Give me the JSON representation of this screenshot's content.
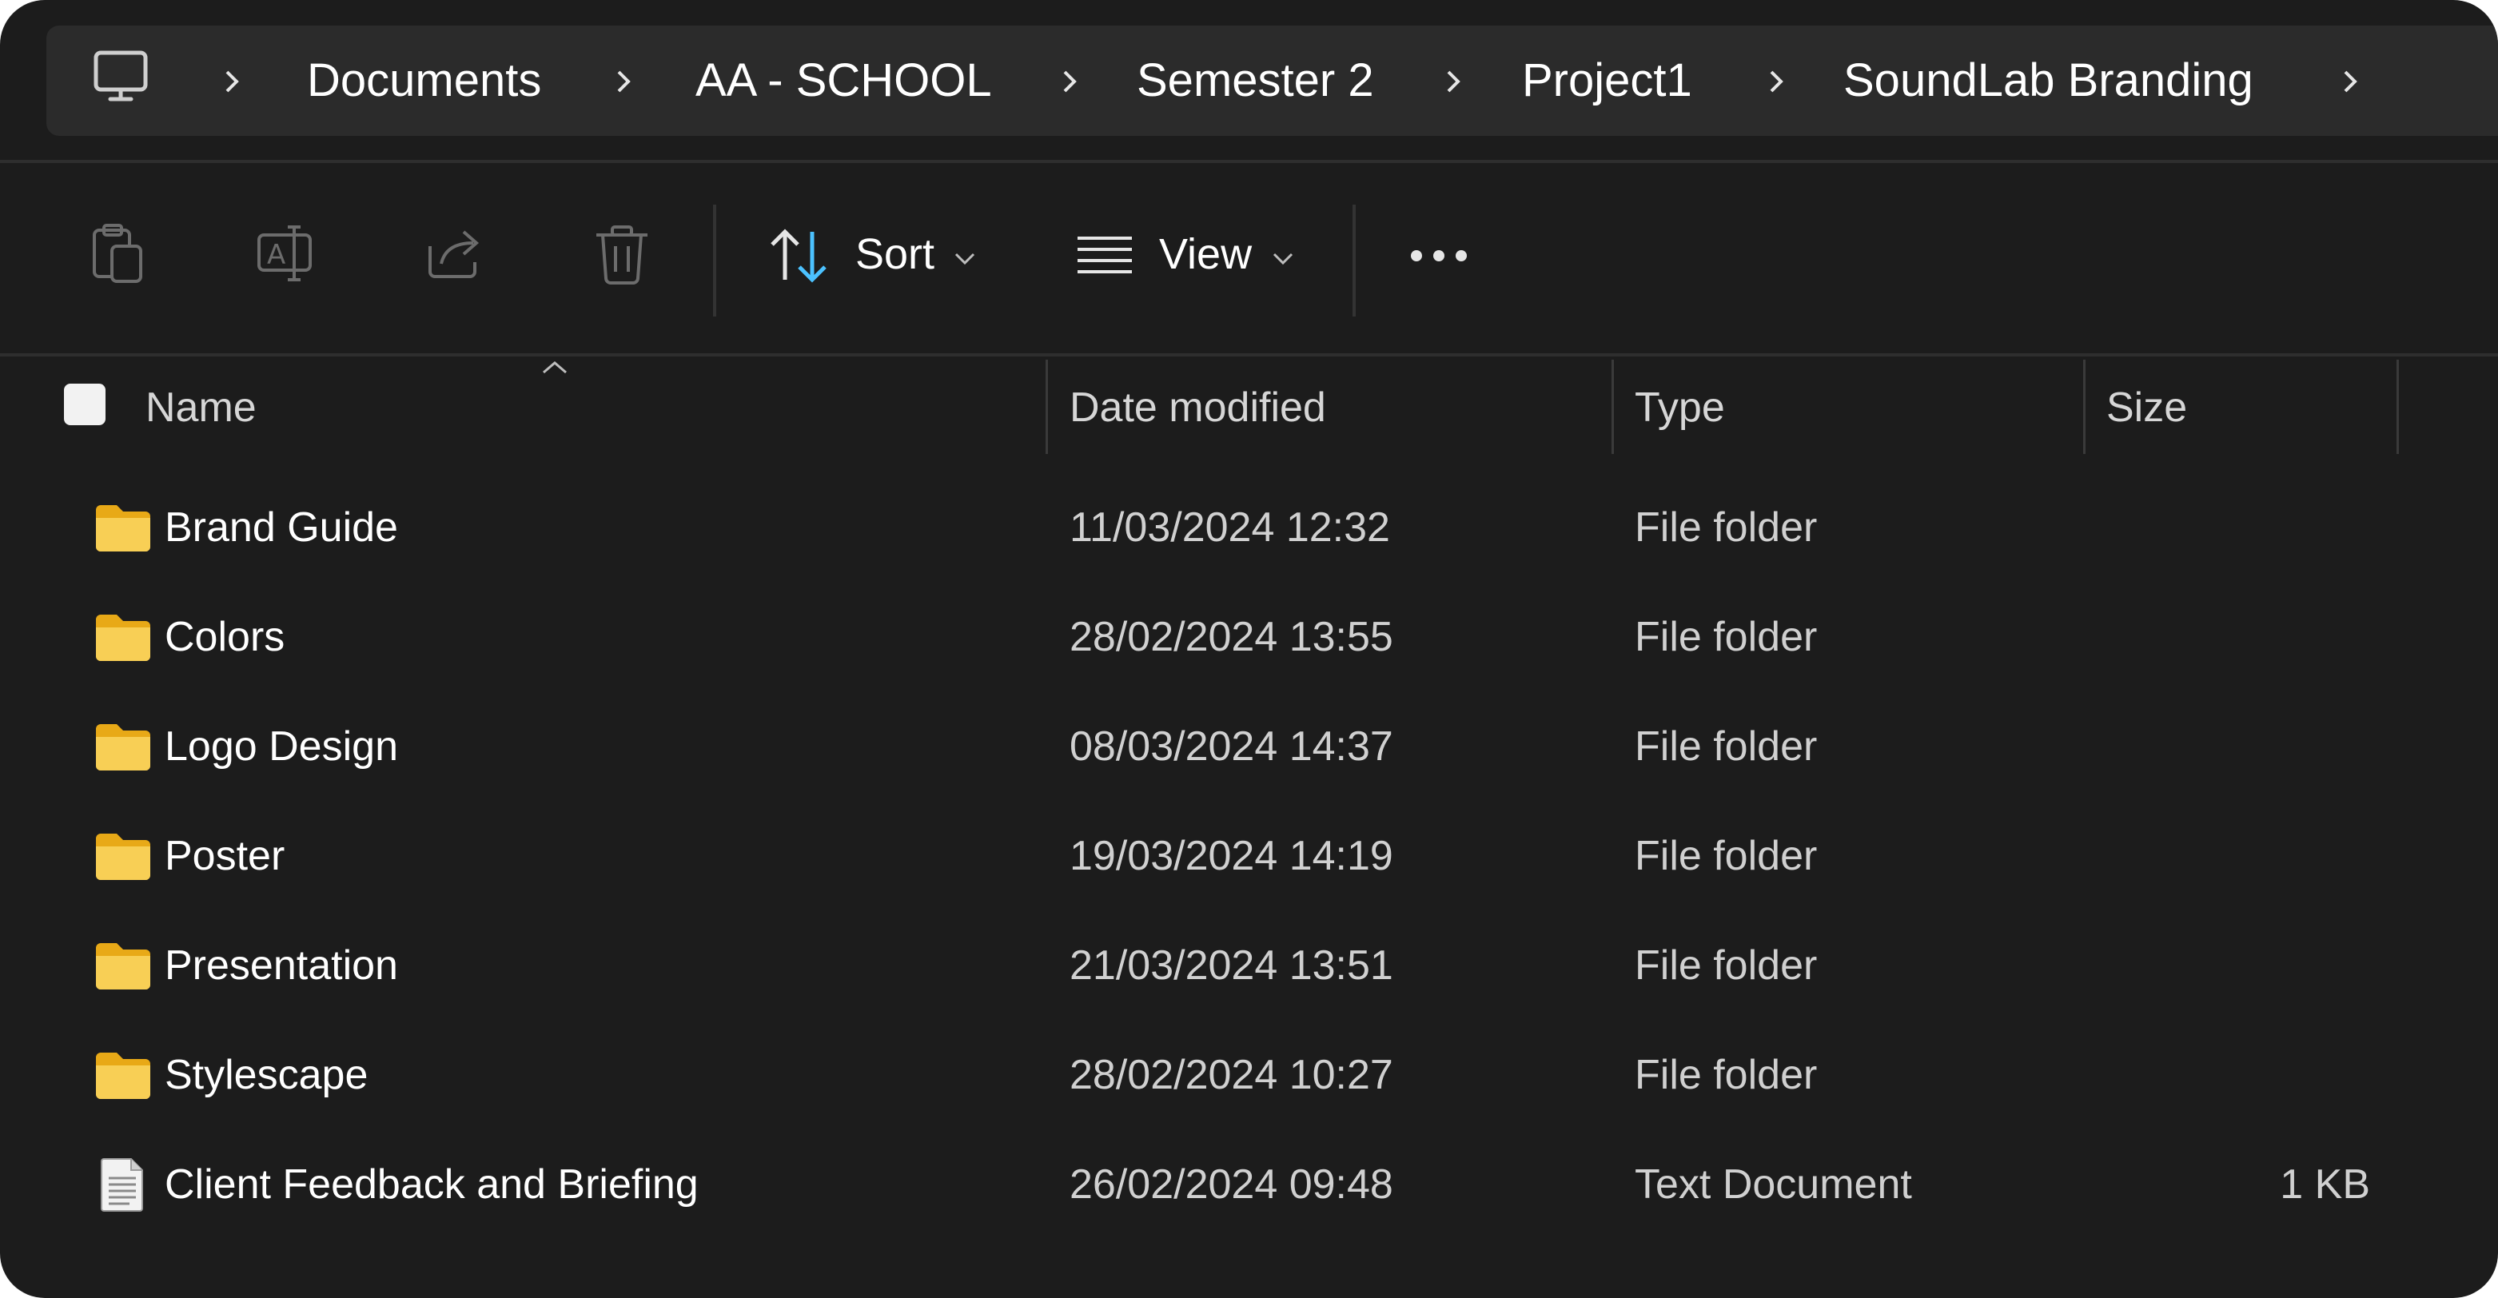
{
  "breadcrumb": {
    "root_icon": "pc-icon",
    "items": [
      "Documents",
      "AA - SCHOOL",
      "Semester 2",
      "Project1",
      "SoundLab Branding"
    ]
  },
  "toolbar": {
    "buttons": [
      "paste-icon",
      "rename-icon",
      "share-icon",
      "delete-icon"
    ],
    "sort_label": "Sort",
    "view_label": "View",
    "more_icon": "more-icon"
  },
  "columns": {
    "name": "Name",
    "date": "Date modified",
    "type": "Type",
    "size": "Size"
  },
  "files": [
    {
      "name": "Brand Guide",
      "date": "11/03/2024 12:32",
      "type": "File folder",
      "size": "",
      "icon": "folder-icon"
    },
    {
      "name": "Colors",
      "date": "28/02/2024 13:55",
      "type": "File folder",
      "size": "",
      "icon": "folder-icon"
    },
    {
      "name": "Logo Design",
      "date": "08/03/2024 14:37",
      "type": "File folder",
      "size": "",
      "icon": "folder-icon"
    },
    {
      "name": "Poster",
      "date": "19/03/2024 14:19",
      "type": "File folder",
      "size": "",
      "icon": "folder-icon"
    },
    {
      "name": "Presentation",
      "date": "21/03/2024 13:51",
      "type": "File folder",
      "size": "",
      "icon": "folder-icon"
    },
    {
      "name": "Stylescape",
      "date": "28/02/2024 10:27",
      "type": "File folder",
      "size": "",
      "icon": "folder-icon"
    },
    {
      "name": "Client Feedback and Briefing",
      "date": "26/02/2024 09:48",
      "type": "Text Document",
      "size": "1 KB",
      "icon": "text-document-icon"
    }
  ],
  "colors": {
    "background": "#1c1c1c",
    "address_bar": "#2b2b2b",
    "folder": "#f5c542",
    "accent": "#4cc2ff"
  }
}
